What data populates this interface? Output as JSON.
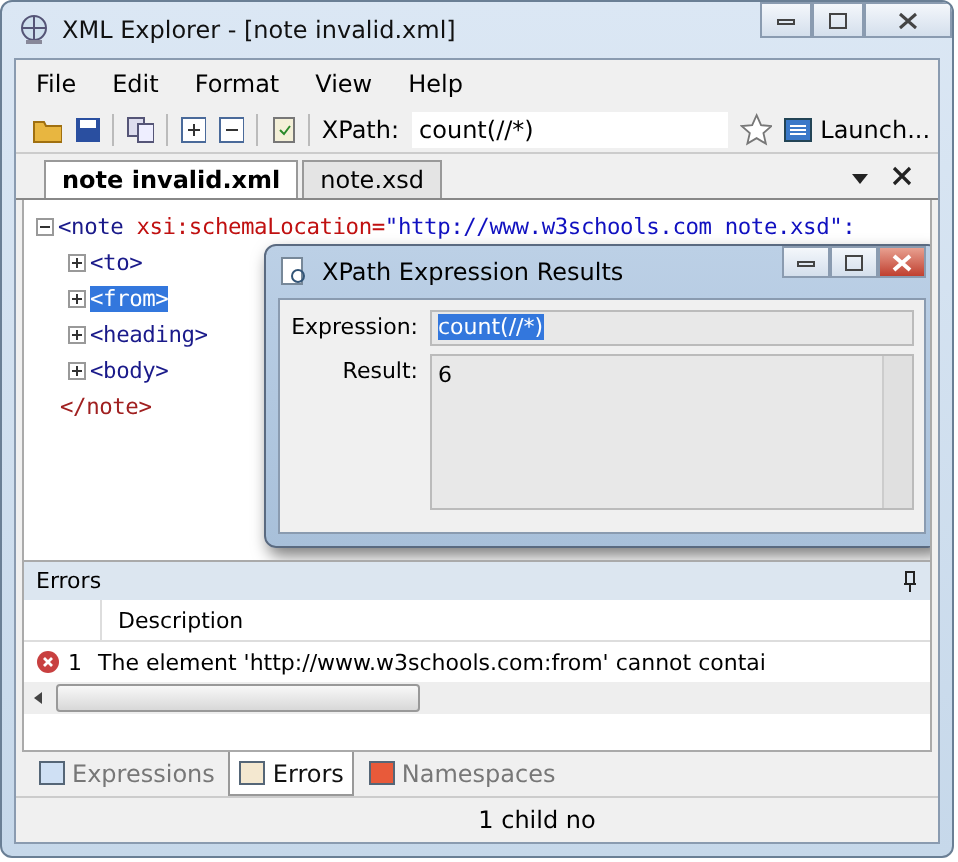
{
  "window": {
    "title": "XML Explorer - [note invalid.xml]"
  },
  "menu": [
    "File",
    "Edit",
    "Format",
    "View",
    "Help"
  ],
  "toolbar": {
    "xpath_label": "XPath:",
    "xpath_value": "count(//*)",
    "launch": "Launch..."
  },
  "doc_tabs": [
    {
      "label": "note invalid.xml",
      "selected": true
    },
    {
      "label": "note.xsd",
      "selected": false
    }
  ],
  "tree": {
    "open": "<note",
    "attr": "xsi:schemaLocation=",
    "value": "\"http://www.w3schools.com note.xsd\":",
    "expanded": true,
    "children": [
      {
        "label": "<to>",
        "selected": false
      },
      {
        "label": "<from>",
        "selected": true
      },
      {
        "label": "<heading>",
        "selected": false
      },
      {
        "label": "<body>",
        "selected": false
      }
    ],
    "close": "</note>"
  },
  "dialog": {
    "title": "XPath Expression Results",
    "expression_label": "Expression:",
    "expression": "count(//*)",
    "result_label": "Result:",
    "result": "6"
  },
  "errors": {
    "title": "Errors",
    "columns": [
      "Description"
    ],
    "rows": [
      {
        "number": "1",
        "description": "The element 'http://www.w3schools.com:from' cannot contai"
      }
    ]
  },
  "bottom_tabs": [
    {
      "label": "Expressions",
      "selected": false
    },
    {
      "label": "Errors",
      "selected": true
    },
    {
      "label": "Namespaces",
      "selected": false
    }
  ],
  "status_bar": "1 child no"
}
